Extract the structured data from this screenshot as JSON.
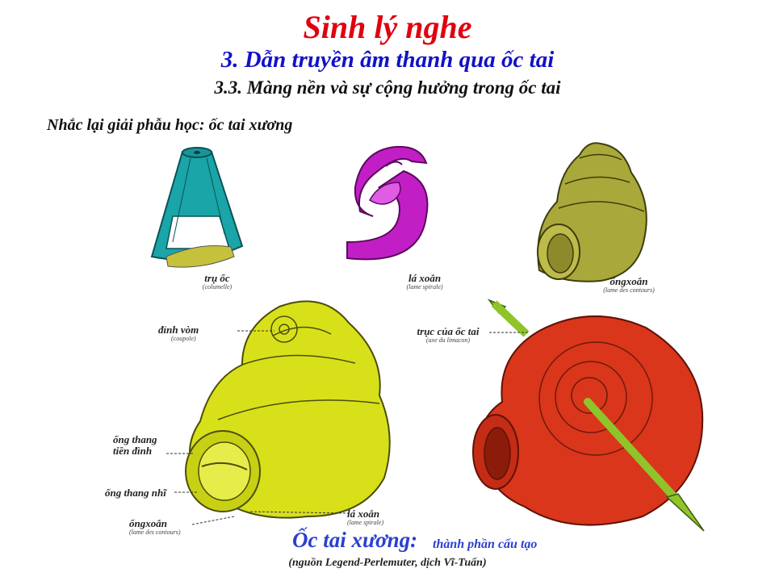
{
  "slide": {
    "title": "Sinh lý nghe",
    "subtitle": "3. Dẫn truyền âm thanh qua ốc tai",
    "section": "3.3. Màng nền và sự cộng hưởng trong ốc tai",
    "intro": "Nhắc lại giải phẫu học: ốc tai xương"
  },
  "figures": {
    "columella": {
      "label": "trụ ốc",
      "latin": "(columelle)",
      "color": "#1aa5a8"
    },
    "spiral_lamina": {
      "label": "lá xoắn",
      "latin": "(lame spirale)",
      "color": "#c21ec6"
    },
    "spiral_canal": {
      "label": "ốngxoắn",
      "latin": "(lame des contours)",
      "color": "#a9a83a"
    },
    "cross_section": {
      "color": "#d8e01a",
      "labels": {
        "cupola": "đỉnh vòm",
        "cupola_latin": "(coupole)",
        "scala_vestibuli_1": "ống thang",
        "scala_vestibuli_2": "tiền đình",
        "scala_tympani": "ống thang nhĩ",
        "spiral_canal": "ốngxoắn",
        "spiral_canal_latin": "(lame des contours)",
        "spiral_lamina": "lá xoắn",
        "spiral_lamina_latin": "(lame spirale)"
      }
    },
    "axis_view": {
      "label": "trục của  ốc tai",
      "latin": "(axe du limacon)",
      "color": "#d9361c",
      "arrow_color": "#8fc42a"
    }
  },
  "caption": {
    "main": "Ốc tai xương:",
    "tail": "thành phần cấu tạo",
    "source": "(nguồn Legend-Perlemuter, dịch Vĩ-Tuấn)"
  }
}
